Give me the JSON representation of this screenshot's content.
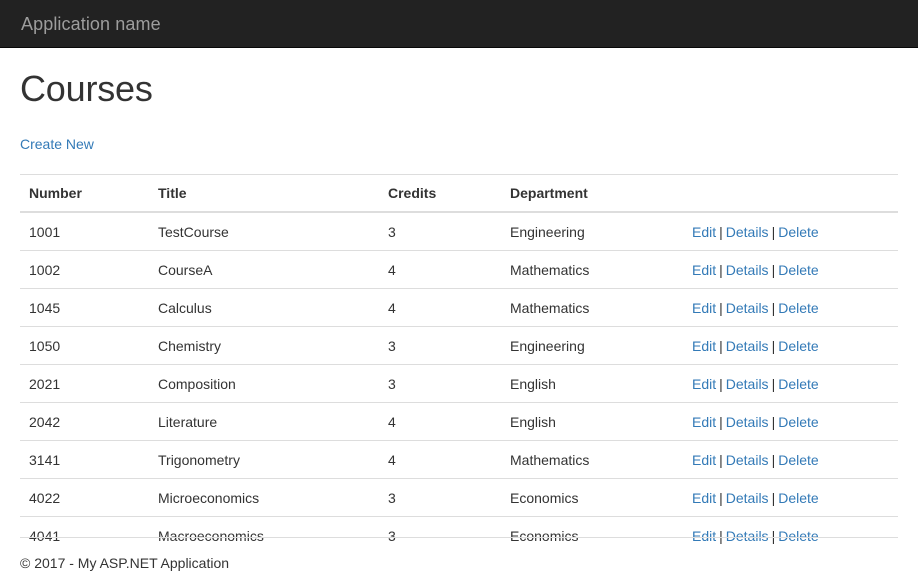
{
  "navbar": {
    "brand": "Application name",
    "background": "#222222",
    "text_color": "#9d9d9d"
  },
  "page": {
    "title": "Courses",
    "create_new_label": "Create New",
    "link_color": "#337ab7"
  },
  "table": {
    "columns": [
      "Number",
      "Title",
      "Credits",
      "Department"
    ],
    "actions": {
      "edit": "Edit",
      "details": "Details",
      "delete": "Delete",
      "separator": "|"
    },
    "rows": [
      {
        "number": "1001",
        "title": "TestCourse",
        "credits": "3",
        "department": "Engineering"
      },
      {
        "number": "1002",
        "title": "CourseA",
        "credits": "4",
        "department": "Mathematics"
      },
      {
        "number": "1045",
        "title": "Calculus",
        "credits": "4",
        "department": "Mathematics"
      },
      {
        "number": "1050",
        "title": "Chemistry",
        "credits": "3",
        "department": "Engineering"
      },
      {
        "number": "2021",
        "title": "Composition",
        "credits": "3",
        "department": "English"
      },
      {
        "number": "2042",
        "title": "Literature",
        "credits": "4",
        "department": "English"
      },
      {
        "number": "3141",
        "title": "Trigonometry",
        "credits": "4",
        "department": "Mathematics"
      },
      {
        "number": "4022",
        "title": "Microeconomics",
        "credits": "3",
        "department": "Economics"
      },
      {
        "number": "4041",
        "title": "Macroeconomics",
        "credits": "3",
        "department": "Economics"
      }
    ]
  },
  "footer": {
    "text": "© 2017 - My ASP.NET Application"
  }
}
